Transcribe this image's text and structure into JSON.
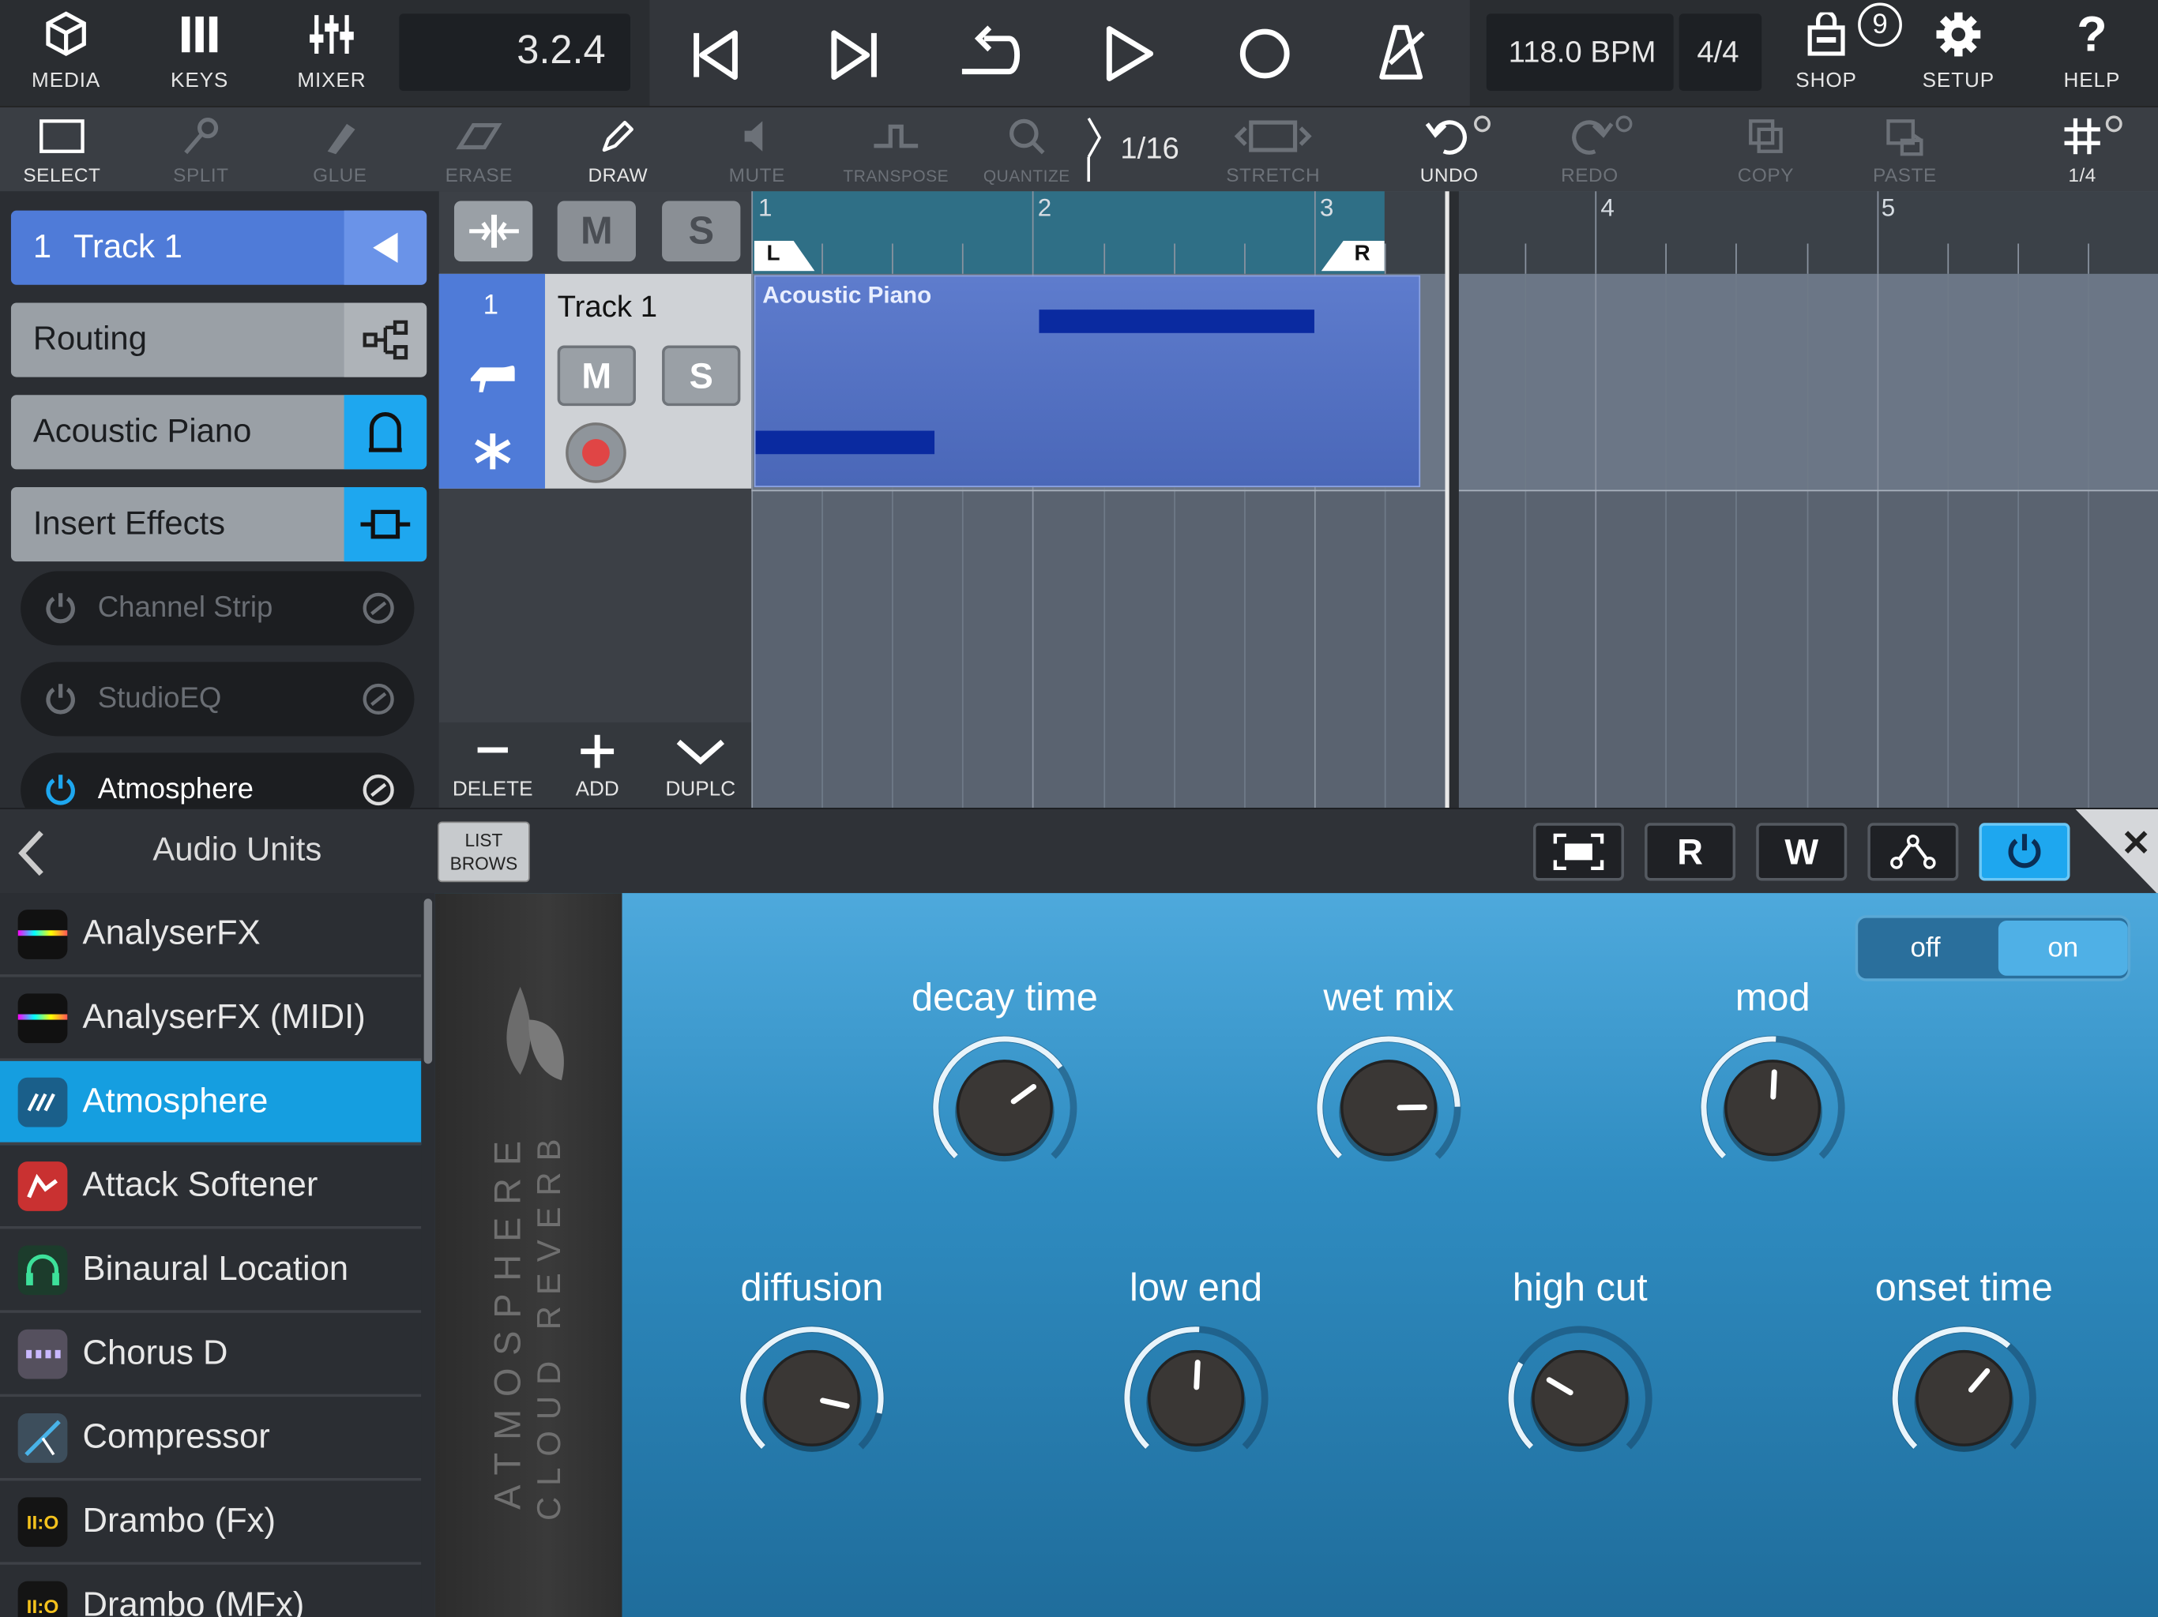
{
  "topbar": {
    "media": "MEDIA",
    "keys": "KEYS",
    "mixer": "MIXER",
    "position": "3.2.4",
    "tempo": "118.0 BPM",
    "signature": "4/4",
    "shop": "SHOP",
    "shop_badge": "9",
    "setup": "SETUP",
    "help": "HELP"
  },
  "toolbar": {
    "select": "SELECT",
    "split": "SPLIT",
    "glue": "GLUE",
    "erase": "ERASE",
    "draw": "DRAW",
    "mute": "MUTE",
    "transpose": "TRANSPOSE",
    "quantize": "QUANTIZE",
    "quantize_value": "1/16",
    "stretch": "STRETCH",
    "undo": "UNDO",
    "redo": "REDO",
    "copy": "COPY",
    "paste": "PASTE",
    "grid_value": "1/4"
  },
  "inspector": {
    "track_number": "1",
    "track_name": "Track 1",
    "routing": "Routing",
    "instrument": "Acoustic Piano",
    "insert_effects": "Insert Effects",
    "effects": [
      {
        "name": "Channel Strip",
        "active": false
      },
      {
        "name": "StudioEQ",
        "active": false
      },
      {
        "name": "Atmosphere",
        "active": true
      }
    ]
  },
  "track_header": {
    "mute_label": "M",
    "solo_label": "S",
    "track_number": "1",
    "track_name": "Track 1",
    "delete": "DELETE",
    "add": "ADD",
    "duplicate": "DUPLC"
  },
  "timeline": {
    "bars": [
      "1",
      "2",
      "3",
      "4",
      "5"
    ],
    "locator_left": "L",
    "locator_right": "R",
    "part_name": "Acoustic Piano"
  },
  "browser": {
    "title": "Audio Units",
    "list_label_1": "LIST",
    "list_label_2": "BROWS",
    "plugins": [
      {
        "name": "AnalyserFX",
        "icon": "spectrum-icon",
        "selected": false
      },
      {
        "name": "AnalyserFX (MIDI)",
        "icon": "spectrum-icon",
        "selected": false
      },
      {
        "name": "Atmosphere",
        "icon": "atmosphere-icon",
        "selected": true
      },
      {
        "name": "Attack Softener",
        "icon": "attack-softener-icon",
        "selected": false
      },
      {
        "name": "Binaural Location",
        "icon": "headphones-icon",
        "selected": false
      },
      {
        "name": "Chorus D",
        "icon": "chorus-icon",
        "selected": false
      },
      {
        "name": "Compressor",
        "icon": "compressor-icon",
        "selected": false
      },
      {
        "name": "Drambo (Fx)",
        "icon": "drambo-icon",
        "selected": false
      },
      {
        "name": "Drambo (MFx)",
        "icon": "drambo-icon",
        "selected": false
      }
    ]
  },
  "plugin_header": {
    "read": "R",
    "write": "W"
  },
  "plugin": {
    "brand_line_1": "ATMOSPHERE",
    "brand_line_2": "CLOUD REVERB",
    "switch_off": "off",
    "switch_on": "on",
    "switch_state": "on",
    "knobs": [
      {
        "label": "decay time",
        "value": 0.7
      },
      {
        "label": "wet mix",
        "value": 0.83
      },
      {
        "label": "mod",
        "value": 0.51
      },
      {
        "label": "diffusion",
        "value": 0.88
      },
      {
        "label": "low end",
        "value": 0.51
      },
      {
        "label": "high cut",
        "value": 0.28
      },
      {
        "label": "onset time",
        "value": 0.65
      }
    ]
  },
  "colors": {
    "accent": "#159ee0",
    "track_blue": "#4f7bd8",
    "part_blue": "#5a76c8",
    "plugin_blue": "#2f8cc1",
    "record_red": "#e04545"
  }
}
